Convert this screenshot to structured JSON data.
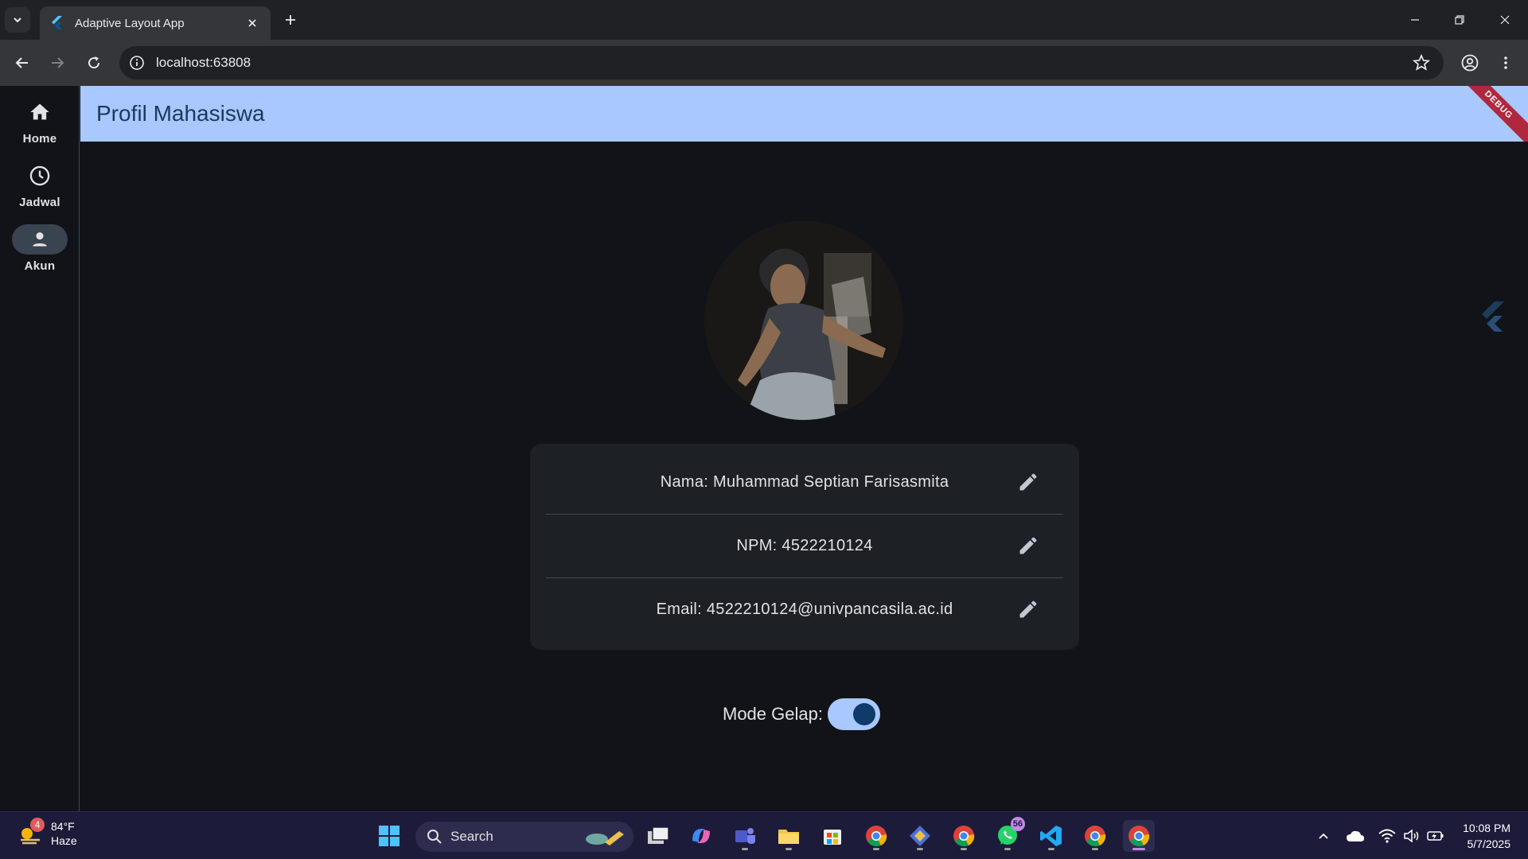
{
  "browser": {
    "tab_title": "Adaptive Layout App",
    "url": "localhost:63808"
  },
  "nav_rail": {
    "items": [
      {
        "label": "Home",
        "icon": "home-icon",
        "selected": false
      },
      {
        "label": "Jadwal",
        "icon": "clock-icon",
        "selected": false
      },
      {
        "label": "Akun",
        "icon": "person-icon",
        "selected": true
      }
    ]
  },
  "app_bar": {
    "title": "Profil Mahasiswa",
    "debug_banner": "DEBUG"
  },
  "profile": {
    "rows": [
      {
        "text": "Nama: Muhammad Septian Farisasmita"
      },
      {
        "text": "NPM: 4522210124"
      },
      {
        "text": "Email: 4522210124@univpancasila.ac.id"
      }
    ]
  },
  "dark_mode": {
    "label": "Mode Gelap:",
    "enabled": true
  },
  "taskbar": {
    "weather_temp": "84°F",
    "weather_desc": "Haze",
    "weather_badge": "4",
    "search_label": "Search",
    "whatsapp_badge": "56",
    "time": "10:08 PM",
    "date": "5/7/2025"
  },
  "colors": {
    "app_bar_bg": "#a8c8ff",
    "background": "#111318",
    "card_bg": "#1d2024",
    "switch_track": "#a8c8ff"
  }
}
